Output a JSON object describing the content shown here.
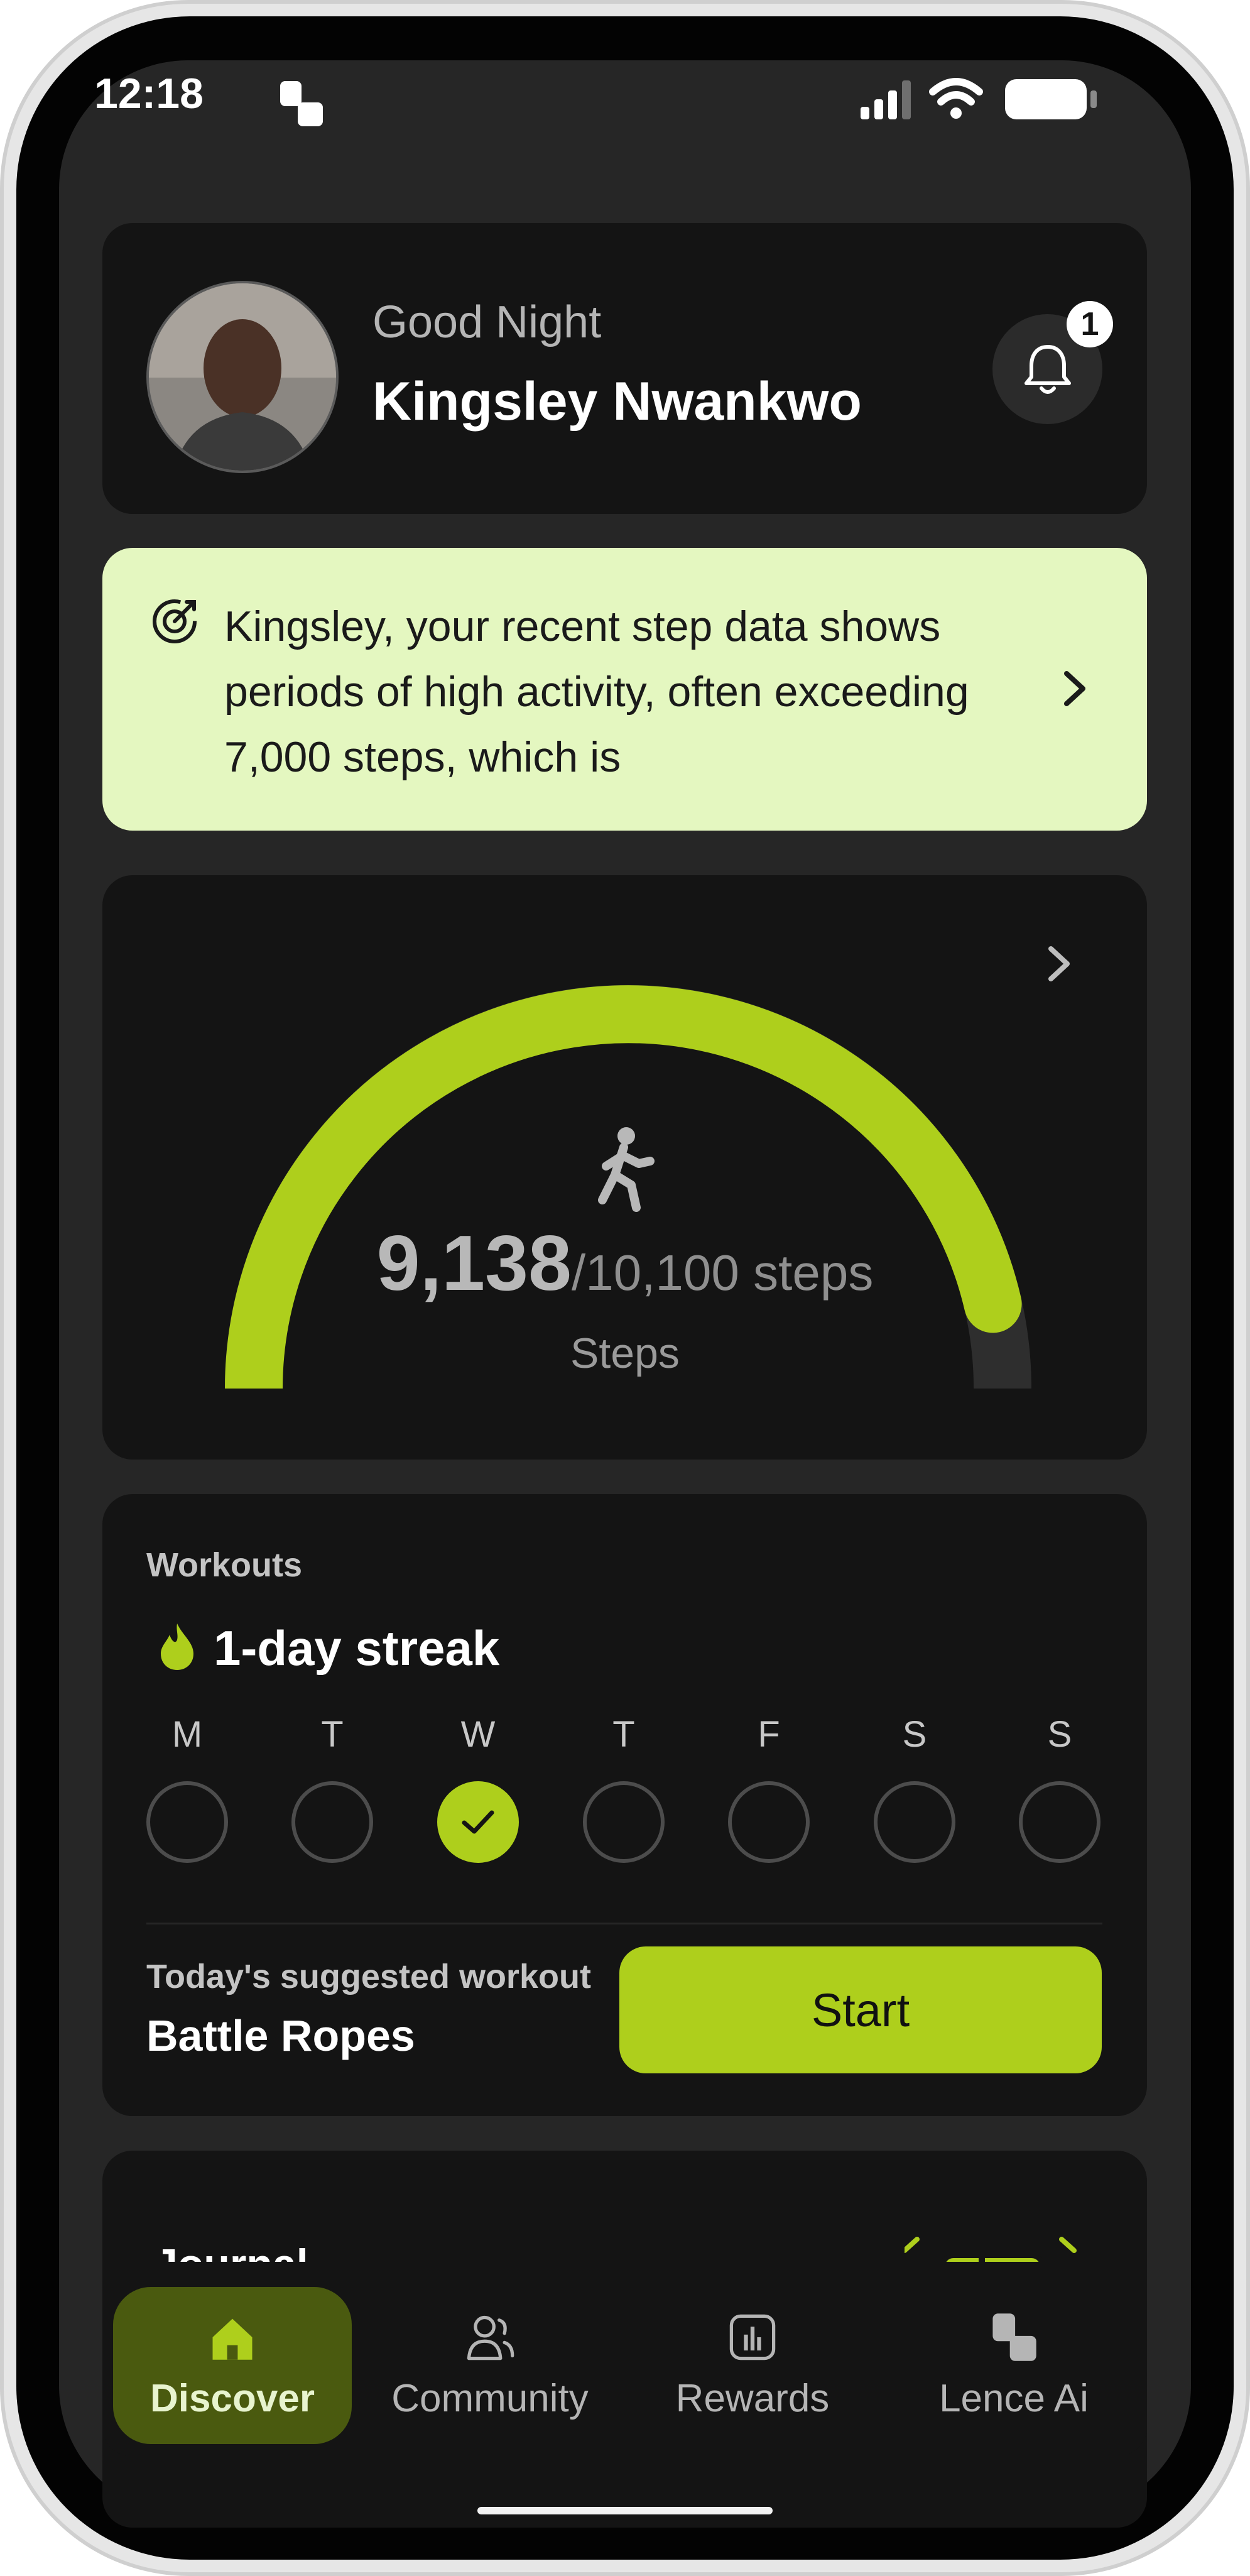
{
  "status_bar": {
    "time": "12:18",
    "icons": [
      "app-icon",
      "signal-icon",
      "wifi-icon",
      "battery-icon"
    ]
  },
  "profile": {
    "greeting": "Good Night",
    "name": "Kingsley Nwankwo",
    "notifications_count": "1"
  },
  "insight": {
    "text": "Kingsley, your recent step data shows periods of high activity, often exceeding 7,000 steps, which is",
    "icon": "target-icon",
    "background": "#e4f7c0"
  },
  "steps": {
    "value": "9,138",
    "goal_text": "/10,100 steps",
    "caption": "Steps",
    "progress": 0.905,
    "accent": "#aecf1c"
  },
  "workouts": {
    "title": "Workouts",
    "streak": "1-day streak",
    "days": [
      {
        "label": "M",
        "done": false
      },
      {
        "label": "T",
        "done": false
      },
      {
        "label": "W",
        "done": true
      },
      {
        "label": "T",
        "done": false
      },
      {
        "label": "F",
        "done": false
      },
      {
        "label": "S",
        "done": false
      },
      {
        "label": "S",
        "done": false
      }
    ],
    "suggested_label": "Today's suggested workout",
    "suggested_name": "Battle Ropes",
    "start_label": "Start"
  },
  "journal": {
    "title": "Journal"
  },
  "nav": {
    "items": [
      {
        "label": "Discover",
        "icon": "home-icon",
        "active": true
      },
      {
        "label": "Community",
        "icon": "community-icon",
        "active": false
      },
      {
        "label": "Rewards",
        "icon": "rewards-icon",
        "active": false
      },
      {
        "label": "Lence Ai",
        "icon": "lence-ai-icon",
        "active": false
      }
    ]
  }
}
